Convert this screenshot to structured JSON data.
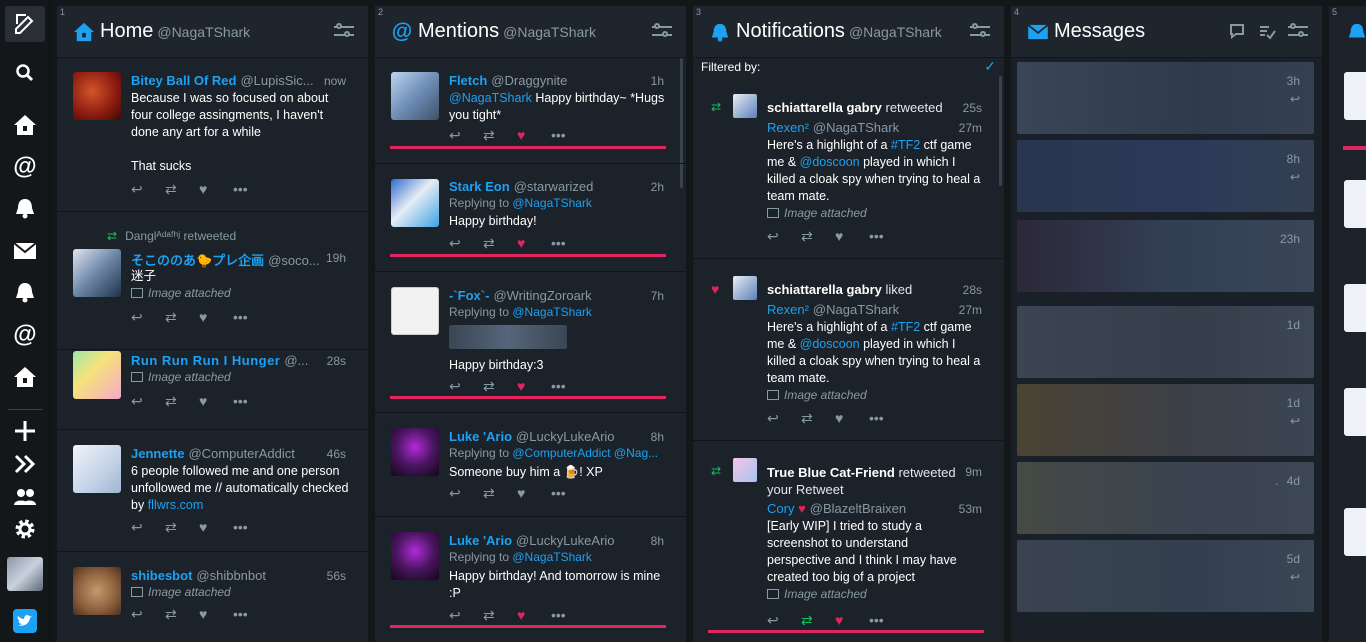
{
  "nav": {
    "items": [
      "compose",
      "search",
      "home",
      "mentions",
      "notifications",
      "messages",
      "notifications",
      "mentions",
      "home",
      "add-column",
      "collapse",
      "accounts",
      "settings"
    ]
  },
  "columns": {
    "home": {
      "num": "1",
      "title": "Home",
      "handle": "@NagaTShark",
      "tweets": [
        {
          "name": "Bitey Ball Of Red",
          "handle": "@LupisSic...",
          "time": "now",
          "text": "Because I was so focused on about four college assingments, I haven't done any art for a while\n\nThat sucks"
        },
        {
          "retweeted_by": "Danglᴬᵈᵃᶠʰʲ retweeted",
          "name": "そこののあ🐤プレ企画",
          "handle": "@soco...",
          "time": "19h",
          "text": "迷子",
          "image": "Image attached"
        },
        {
          "name": "Run Run Run I Hunger",
          "handle": "@...",
          "time": "28s",
          "image": "Image attached"
        },
        {
          "name": "Jennette",
          "handle": "@ComputerAddict",
          "time": "46s",
          "text": "6 people followed me and one person unfollowed me // automatically checked by ",
          "link": "fllwrs.com"
        },
        {
          "name": "shibesbot",
          "handle": "@shibbnbot",
          "time": "56s",
          "image": "Image attached"
        }
      ]
    },
    "mentions": {
      "num": "2",
      "title": "Mentions",
      "handle": "@NagaTShark",
      "tweets": [
        {
          "name": "Fletch",
          "handle": "@Draggynite",
          "time": "1h",
          "mention": "@NagaTShark",
          "text": " Happy birthday~ *Hugs you tight*"
        },
        {
          "name": "Stark Eon",
          "handle": "@starwarized",
          "time": "2h",
          "reply_label": "Replying to ",
          "reply_to": "@NagaTShark",
          "text": "Happy birthday!"
        },
        {
          "name": "-`Fox`-",
          "handle": "@WritingZoroark",
          "time": "7h",
          "reply_label": "Replying to ",
          "reply_to": "@NagaTShark",
          "text": "Happy birthday:3"
        },
        {
          "name": "Luke 'Ario",
          "handle": "@LuckyLukeArio",
          "time": "8h",
          "reply_label": "Replying to ",
          "reply_to": "@ComputerAddict @Nag...",
          "text": "Someone buy him a 🍺! XP"
        },
        {
          "name": "Luke 'Ario",
          "handle": "@LuckyLukeArio",
          "time": "8h",
          "reply_label": "Replying to ",
          "reply_to": "@NagaTShark",
          "text": "Happy birthday! And tomorrow is mine :P"
        }
      ]
    },
    "notifications": {
      "num": "3",
      "title": "Notifications",
      "handle": "@NagaTShark",
      "filtered_label": "Filtered by:",
      "items": [
        {
          "who": "schiattarella gabry",
          "action": " retweeted",
          "time": "25s",
          "name": "Rexen²",
          "handle": "@NagaTShark",
          "ttime": "27m",
          "t1": "Here's a highlight of a ",
          "tag": "#TF2",
          "t2": " ctf game me & ",
          "user": "@doscoon",
          "t3": " played in which I killed a cloak spy when trying to heal a team mate.",
          "image": "Image attached"
        },
        {
          "who": "schiattarella gabry",
          "action": " liked",
          "time": "28s",
          "name": "Rexen²",
          "handle": "@NagaTShark",
          "ttime": "27m",
          "t1": "Here's a highlight of a ",
          "tag": "#TF2",
          "t2": " ctf game me & ",
          "user": "@doscoon",
          "t3": " played in which I killed a cloak spy when trying to heal a team mate.",
          "image": "Image attached"
        },
        {
          "who": "True Blue Cat-Friend",
          "action": " retweeted",
          "action2": "your Retweet",
          "time": "9m",
          "name": "Cory",
          "handle": "@BlazeltBraixen",
          "ttime": "53m",
          "text": "[Early WIP] I tried to study a screenshot to understand perspective and I think I may have created too big of a project",
          "image": "Image attached"
        }
      ]
    },
    "messages": {
      "num": "4",
      "title": "Messages",
      "items": [
        {
          "time": "3h"
        },
        {
          "time": "8h"
        },
        {
          "time": "23h"
        },
        {
          "time": "1d"
        },
        {
          "time": "1d"
        },
        {
          "time": "4d",
          "prefix": "."
        },
        {
          "time": "5d"
        }
      ]
    },
    "col5": {
      "num": "5"
    }
  },
  "colors": {
    "accent": "#1da1f2",
    "like": "#e0245e",
    "retweet": "#17bf63",
    "column_bg": "#1c2229",
    "app_bg": "#14171a"
  }
}
